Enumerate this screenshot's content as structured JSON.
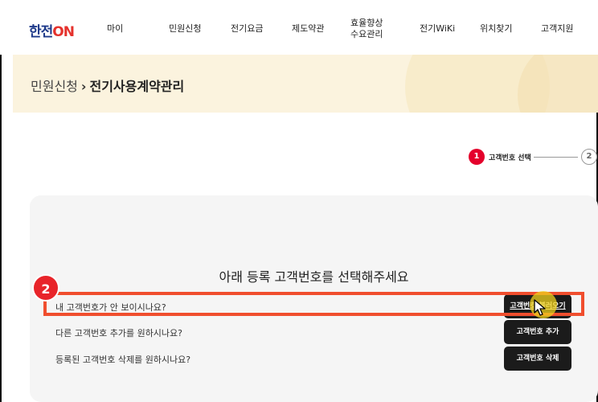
{
  "header": {
    "logo_main": "한전",
    "logo_on": "ON",
    "nav": [
      {
        "label": "마이"
      },
      {
        "label": "민원신청"
      },
      {
        "label": "전기요금"
      },
      {
        "label": "제도약관"
      },
      {
        "label": "효율향상\n수요관리"
      },
      {
        "label": "전기WiKi"
      },
      {
        "label": "위치찾기"
      },
      {
        "label": "고객지원"
      }
    ]
  },
  "breadcrumb": {
    "parent": "민원신청",
    "separator": "›",
    "current": "전기사용계약관리"
  },
  "stepper": {
    "step1_number": "1",
    "step1_label": "고객번호 선택",
    "step2_number": "2"
  },
  "panel": {
    "title": "아래 등록 고객번호를 선택해주세요",
    "rows": [
      {
        "question": "내 고객번호가 안 보이시나요?",
        "button": "고객번호 불러오기"
      },
      {
        "question": "다른 고객번호 추가를 원하시나요?",
        "button": "고객번호 추가"
      },
      {
        "question": "등록된 고객번호 삭제를 원하시나요?",
        "button": "고객번호 삭제"
      }
    ]
  },
  "annotation": {
    "badge_number": "2",
    "highlight_color": "#f04e2e",
    "badge_color": "#e8242a"
  },
  "colors": {
    "brand_blue": "#1e3a8a",
    "brand_red": "#e5322d",
    "banner_bg": "#fbf3de",
    "step_active": "#e4002b",
    "button_bg": "#1b1b1b"
  }
}
